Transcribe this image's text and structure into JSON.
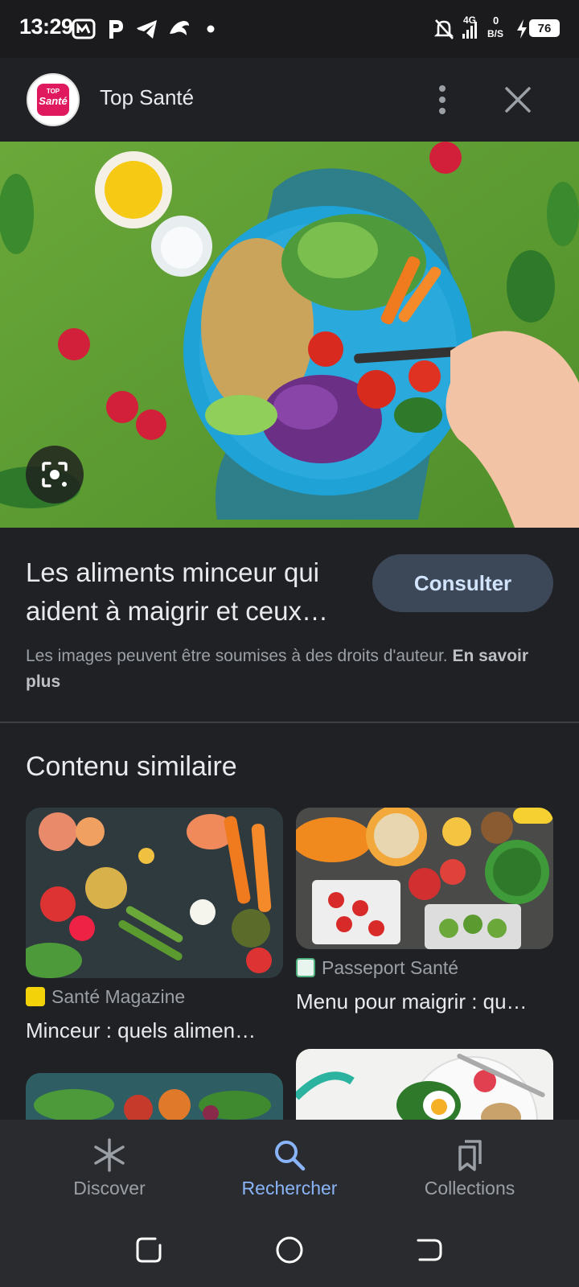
{
  "status_bar": {
    "time": "13:29",
    "network": "4G",
    "speed_top": "0",
    "speed_bottom": "B/S",
    "battery": "76",
    "icons": [
      "gallery-icon",
      "p-app-icon",
      "telegram-icon",
      "bird-app-icon",
      "dot-icon",
      "mute-icon",
      "signal-icon",
      "charging-icon",
      "battery-icon"
    ]
  },
  "header": {
    "logo_top": "TOP",
    "logo_main": "Santé",
    "site_name": "Top Santé"
  },
  "hero": {
    "image_alt_icon": "lens-icon"
  },
  "result": {
    "title": "Les aliments minceur qui aident à maigrir et ceux…",
    "consult_label": "Consulter",
    "copyright_text": "Les images peuvent être soumises à des droits d'auteur.",
    "learn_more": "En savoir plus"
  },
  "similar": {
    "heading": "Contenu similaire",
    "cards": [
      {
        "source": "Santé Magazine",
        "title": "Minceur : quels alimen…"
      },
      {
        "source": "Passeport Santé",
        "title": "Menu pour maigrir : qu…"
      },
      {
        "source": "",
        "title": ""
      },
      {
        "source": "",
        "title": ""
      }
    ]
  },
  "bottom_nav": {
    "items": [
      {
        "label": "Discover",
        "icon": "asterisk-icon"
      },
      {
        "label": "Rechercher",
        "icon": "search-icon"
      },
      {
        "label": "Collections",
        "icon": "collections-icon"
      }
    ],
    "active": "Rechercher",
    "active_color": "#8ab4f8"
  }
}
